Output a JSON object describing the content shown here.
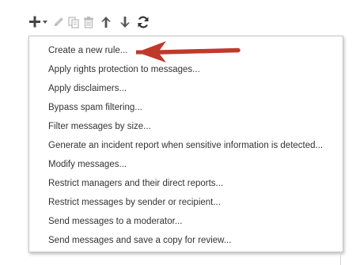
{
  "toolbar": {
    "icons": [
      "plus-icon",
      "chevron-down-icon",
      "pencil-icon",
      "copy-icon",
      "trash-icon",
      "arrow-up-icon",
      "arrow-down-icon",
      "refresh-icon"
    ]
  },
  "menu": {
    "items": [
      "Create a new rule...",
      "Apply rights protection to messages...",
      "Apply disclaimers...",
      "Bypass spam filtering...",
      "Filter messages by size...",
      "Generate an incident report when sensitive information is detected...",
      "Modify messages...",
      "Restrict managers and their direct reports...",
      "Restrict messages by sender or recipient...",
      "Send messages to a moderator...",
      "Send messages and save a copy for review..."
    ]
  },
  "colors": {
    "icon_active": "#444444",
    "icon_disabled": "#bbbbbb",
    "refresh": "#333333",
    "annotation_arrow": "#c0392b",
    "menu_text": "#333333"
  }
}
